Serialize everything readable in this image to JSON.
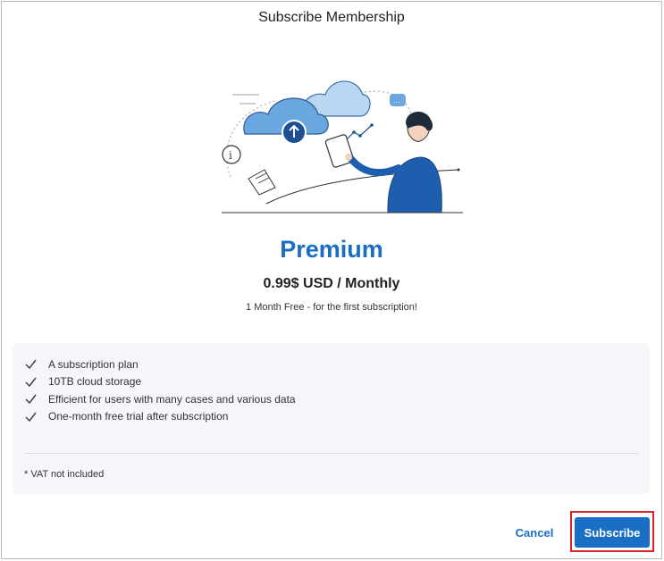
{
  "dialog": {
    "title": "Subscribe Membership"
  },
  "illustration": {
    "icon": "cloud-upload-person-tablet-illustration"
  },
  "plan": {
    "name": "Premium",
    "price": "0.99$ USD / Monthly",
    "promo": "1 Month Free - for the first subscription!"
  },
  "features": {
    "items": [
      "A subscription plan",
      "10TB cloud storage",
      "Efficient for users with many cases and various data",
      "One-month free trial after subscription"
    ],
    "note": "* VAT not included"
  },
  "actions": {
    "cancel_label": "Cancel",
    "subscribe_label": "Subscribe"
  },
  "colors": {
    "accent": "#1a6fc4",
    "highlight": "#d9242b",
    "panel_bg": "#f4f6f9"
  }
}
